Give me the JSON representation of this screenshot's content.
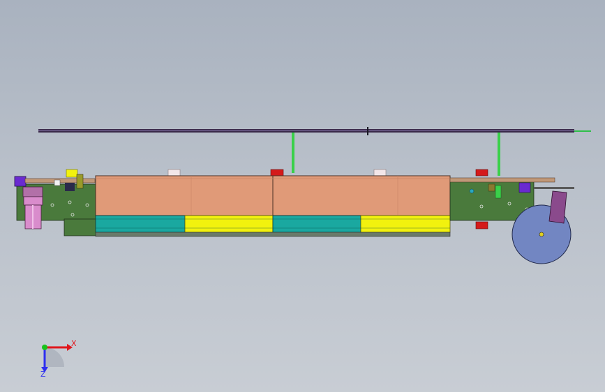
{
  "view": {
    "background_top": "#a9b2bf",
    "background_bottom": "#c8cdd4"
  },
  "triad": {
    "x_label": "X",
    "z_label": "Z",
    "x_color": "#e0161c",
    "y_color": "#18c21c",
    "z_color": "#2d2ef0"
  },
  "model": {
    "frame_color": "#4a7a3c",
    "cover_color": "#e09a78",
    "band_cyan_color": "#1aa8a0",
    "band_yellow_color": "#f2f20e",
    "wheel_color": "#7286c2",
    "motor_color": "#d98ccc",
    "rail_color": "#3a2a4a",
    "post_color": "#3ad04a",
    "marker_red_color": "#d41a1a",
    "marker_pink_color": "#f2e6e8"
  }
}
